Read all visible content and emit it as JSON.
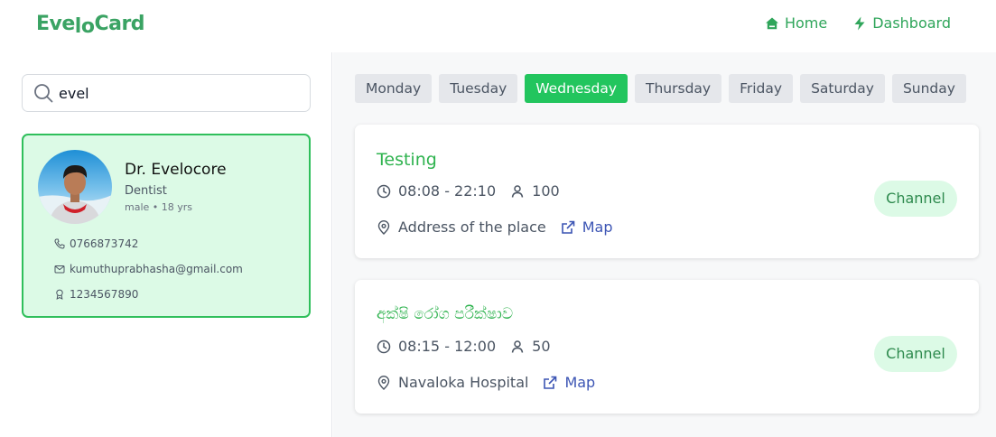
{
  "app": {
    "logo_part1": "Eve",
    "logo_part2": "lo",
    "logo_part3": "Card"
  },
  "nav": {
    "home_label": "Home",
    "dashboard_label": "Dashboard"
  },
  "search": {
    "value": "evel"
  },
  "doctor": {
    "name": "Dr. Evelocore",
    "specialty": "Dentist",
    "meta": "male • 18 yrs",
    "phone": "0766873742",
    "email": "kumuthuprabhasha@gmail.com",
    "reg_no": "1234567890"
  },
  "days": [
    {
      "label": "Monday",
      "active": false
    },
    {
      "label": "Tuesday",
      "active": false
    },
    {
      "label": "Wednesday",
      "active": true
    },
    {
      "label": "Thursday",
      "active": false
    },
    {
      "label": "Friday",
      "active": false
    },
    {
      "label": "Saturday",
      "active": false
    },
    {
      "label": "Sunday",
      "active": false
    }
  ],
  "sessions": [
    {
      "title": "Testing",
      "time": "08:08 - 22:10",
      "capacity": "100",
      "address": "Address of the place",
      "map_label": "Map",
      "channel_label": "Channel"
    },
    {
      "title": "අක්ෂි රෝග පරීක්ෂාව",
      "time": "08:15 - 12:00",
      "capacity": "50",
      "address": "Navaloka Hospital",
      "map_label": "Map",
      "channel_label": "Channel"
    }
  ],
  "colors": {
    "brand": "#3aa363",
    "accent": "#22c55e",
    "card_bg": "#dcfae6",
    "link": "#3c55b4"
  }
}
